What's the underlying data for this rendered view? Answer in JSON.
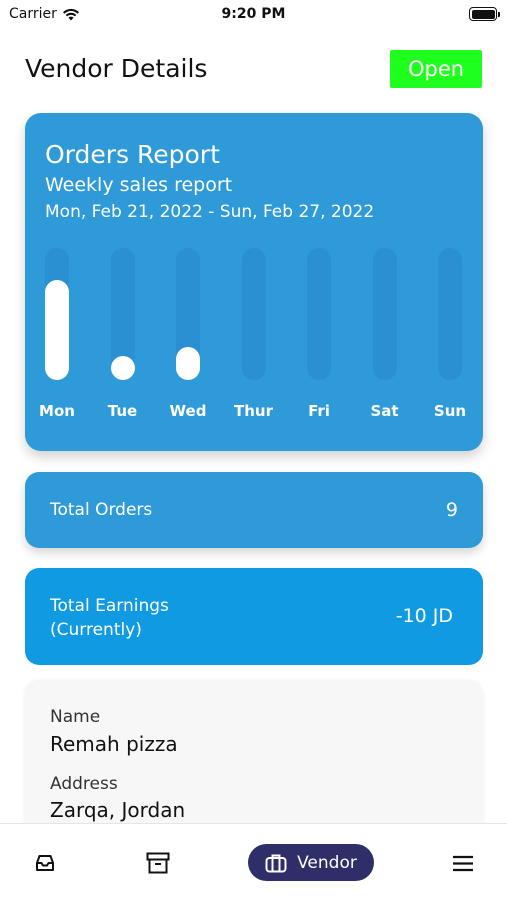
{
  "status_bar": {
    "carrier": "Carrier",
    "time": "9:20 PM"
  },
  "header": {
    "title": "Vendor Details",
    "status_button": "Open",
    "status_color": "#1eff1e"
  },
  "report": {
    "title": "Orders Report",
    "subtitle": "Weekly sales report",
    "date_range": "Mon, Feb 21, 2022  -  Sun, Feb 27, 2022"
  },
  "chart_data": {
    "type": "bar",
    "categories": [
      "Mon",
      "Tue",
      "Wed",
      "Thur",
      "Fri",
      "Sat",
      "Sun"
    ],
    "values": [
      0.76,
      0.18,
      0.25,
      0,
      0,
      0,
      0
    ],
    "ylim": [
      0,
      1
    ],
    "grid": false
  },
  "summary": {
    "orders_label": "Total Orders",
    "orders_value": "9",
    "earnings_label_line1": "Total Earnings",
    "earnings_label_line2": "(Currently)",
    "earnings_value": "-10 JD"
  },
  "vendor_info": {
    "name_label": "Name",
    "name_value": "Remah pizza",
    "address_label": "Address",
    "address_value": "Zarqa, Jordan"
  },
  "tab_bar": {
    "items": [
      {
        "icon": "inbox-icon"
      },
      {
        "icon": "archive-icon"
      },
      {
        "icon": "briefcase-icon",
        "label": "Vendor",
        "active": true
      },
      {
        "icon": "menu-icon"
      }
    ],
    "active_color": "#2e2e68"
  },
  "colors": {
    "card_blue": "#2f9ad8",
    "earnings_blue": "#0f9ae2"
  }
}
